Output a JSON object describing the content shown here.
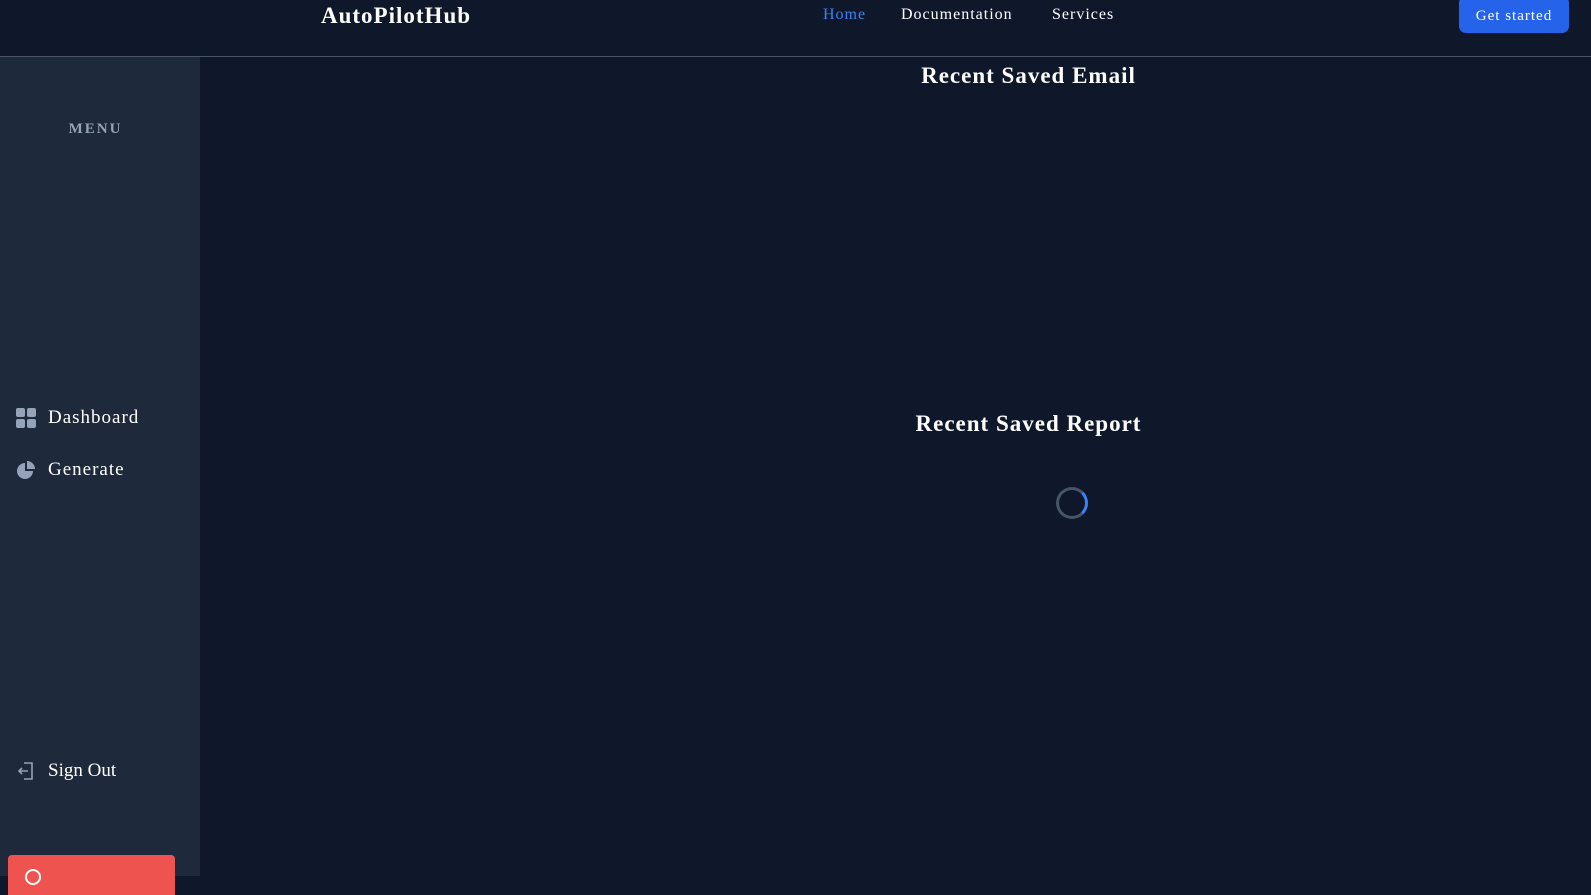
{
  "header": {
    "brand": "AutoPilotHub",
    "nav": [
      {
        "label": "Home",
        "active": true
      },
      {
        "label": "Documentation",
        "active": false
      },
      {
        "label": "Services",
        "active": false
      }
    ],
    "cta_label": "Get started"
  },
  "sidebar": {
    "heading": "MENU",
    "items": [
      {
        "label": "Dashboard",
        "icon": "grid-icon"
      },
      {
        "label": "Generate",
        "icon": "pie-chart-icon"
      }
    ],
    "signout": {
      "label": "Sign Out",
      "icon": "sign-out-icon"
    },
    "bottom_button": {
      "icon": "help-icon",
      "color": "#ef5350"
    }
  },
  "main": {
    "email_section_title": "Recent Saved Email",
    "report_section_title": "Recent Saved Report",
    "report_loading": true
  },
  "colors": {
    "background": "#0f172a",
    "sidebar": "#1e293b",
    "accent": "#3b82f6",
    "button": "#2563eb",
    "danger": "#ef5350"
  }
}
